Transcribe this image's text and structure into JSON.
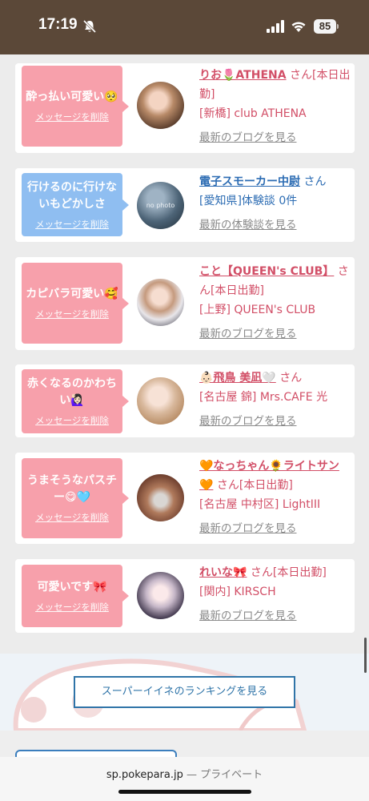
{
  "status": {
    "time": "17:19",
    "battery": "85"
  },
  "posts": [
    {
      "message": "酔っ払い可愛い🥺",
      "delete_label": "メッセージを削除",
      "name": "りお🌷ATHENA",
      "san": "さん[本日出勤]",
      "shop": "[新橋] club ATHENA",
      "latest": "最新のブログを見る"
    },
    {
      "message": "行けるのに行けないもどかしさ",
      "delete_label": "メッセージを削除",
      "name": "電子スモーカー中尉",
      "san": "さん",
      "shop": "[愛知県]体験談 0件",
      "latest": "最新の体験談を見る",
      "avatar_label": "no photo"
    },
    {
      "message": "カピバラ可愛い🥰",
      "delete_label": "メッセージを削除",
      "name": "こと【QUEEN's CLUB】",
      "san": "さん[本日出勤]",
      "shop": "[上野] QUEEN's CLUB",
      "latest": "最新のブログを見る"
    },
    {
      "message": "赤くなるのかわちい🙋🏻‍♀️",
      "delete_label": "メッセージを削除",
      "name": "👶🏻飛鳥 美凪🤍",
      "san": "さん",
      "shop": "[名古屋 錦] Mrs.CAFE 光",
      "latest": "最新のブログを見る"
    },
    {
      "message": "うまそうなパスチー😋🩵",
      "delete_label": "メッセージを削除",
      "name": "🧡なっちゃん🌻ライトサン🧡",
      "san": "さん[本日出勤]",
      "shop": "[名古屋 中村区] LightIII",
      "latest": "最新のブログを見る"
    },
    {
      "message": "可愛いです🎀",
      "delete_label": "メッセージを削除",
      "name": "れいな🎀",
      "san": "さん[本日出勤]",
      "shop": "[関内] KIRSCH",
      "latest": "最新のブログを見る"
    }
  ],
  "ranking_button": "スーパーイイネのランキングを見る",
  "browser": {
    "domain": "sp.pokepara.jp",
    "privacy": " — プライベート"
  }
}
